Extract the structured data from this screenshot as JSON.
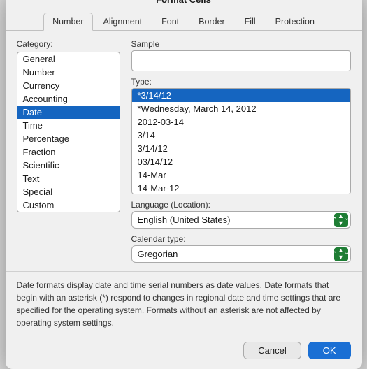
{
  "dialog": {
    "title": "Format Cells"
  },
  "tabs": [
    {
      "label": "Number",
      "active": true
    },
    {
      "label": "Alignment",
      "active": false
    },
    {
      "label": "Font",
      "active": false
    },
    {
      "label": "Border",
      "active": false
    },
    {
      "label": "Fill",
      "active": false
    },
    {
      "label": "Protection",
      "active": false
    }
  ],
  "category": {
    "label": "Category:",
    "items": [
      {
        "label": "General",
        "selected": false
      },
      {
        "label": "Number",
        "selected": false
      },
      {
        "label": "Currency",
        "selected": false
      },
      {
        "label": "Accounting",
        "selected": false
      },
      {
        "label": "Date",
        "selected": true
      },
      {
        "label": "Time",
        "selected": false
      },
      {
        "label": "Percentage",
        "selected": false
      },
      {
        "label": "Fraction",
        "selected": false
      },
      {
        "label": "Scientific",
        "selected": false
      },
      {
        "label": "Text",
        "selected": false
      },
      {
        "label": "Special",
        "selected": false
      },
      {
        "label": "Custom",
        "selected": false
      }
    ]
  },
  "sample": {
    "label": "Sample",
    "value": ""
  },
  "type": {
    "label": "Type:",
    "items": [
      {
        "label": "*3/14/12",
        "selected": true
      },
      {
        "label": "*Wednesday, March 14, 2012",
        "selected": false
      },
      {
        "label": "2012-03-14",
        "selected": false
      },
      {
        "label": "3/14",
        "selected": false
      },
      {
        "label": "3/14/12",
        "selected": false
      },
      {
        "label": "03/14/12",
        "selected": false
      },
      {
        "label": "14-Mar",
        "selected": false
      },
      {
        "label": "14-Mar-12",
        "selected": false
      }
    ]
  },
  "language": {
    "label": "Language (Location):",
    "value": "English (United States)",
    "options": [
      "English (United States)"
    ]
  },
  "calendar": {
    "label": "Calendar type:",
    "value": "Gregorian",
    "options": [
      "Gregorian"
    ]
  },
  "description": "Date formats display date and time serial numbers as date values.  Date formats that begin with an asterisk (*) respond to changes in regional date and time settings that are specified for the operating system. Formats without an asterisk are not affected by operating system settings.",
  "buttons": {
    "cancel": "Cancel",
    "ok": "OK"
  }
}
